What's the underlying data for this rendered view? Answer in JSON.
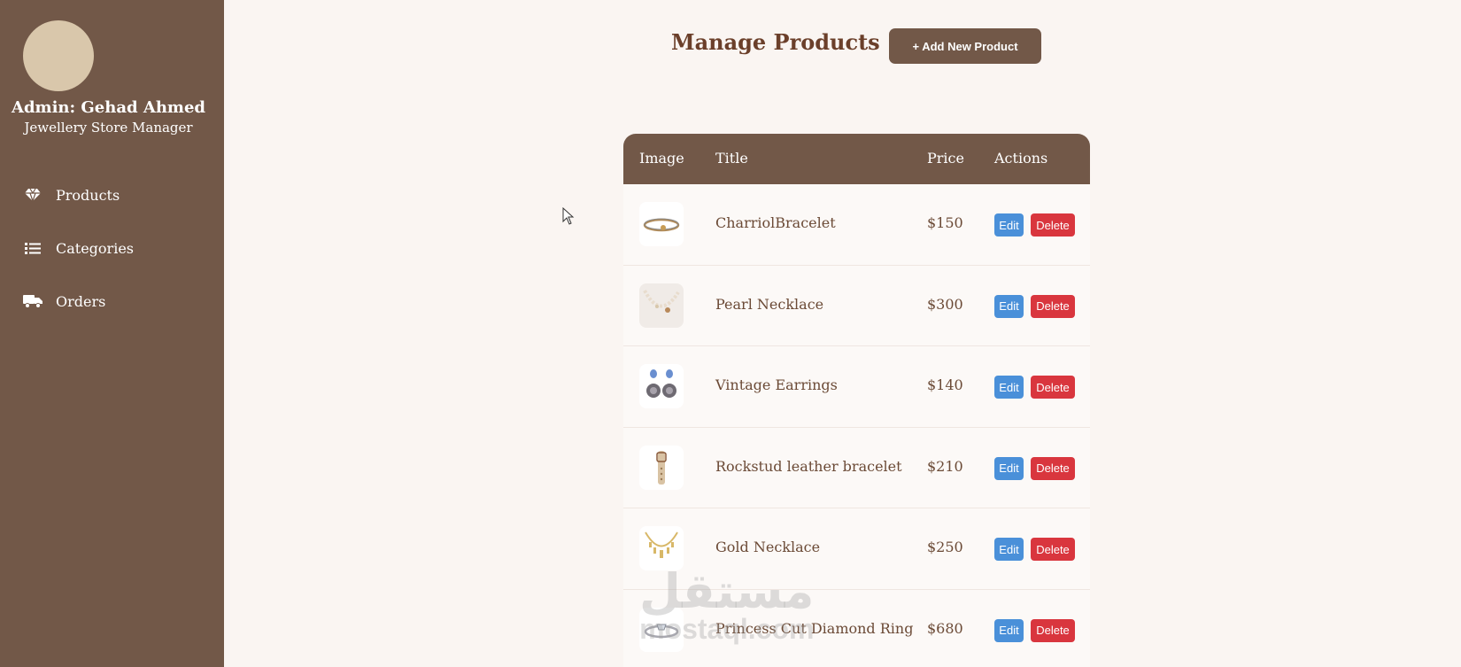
{
  "sidebar": {
    "admin_name": "Admin: Gehad Ahmed",
    "admin_role": "Jewellery Store Manager",
    "items": [
      {
        "label": "Products",
        "icon": "gem-icon"
      },
      {
        "label": "Categories",
        "icon": "list-icon"
      },
      {
        "label": "Orders",
        "icon": "truck-icon"
      }
    ]
  },
  "header": {
    "title": "Manage Products",
    "add_button": "+ Add New Product"
  },
  "table": {
    "columns": [
      "Image",
      "Title",
      "Price",
      "Actions"
    ],
    "edit_label": "Edit",
    "delete_label": "Delete",
    "rows": [
      {
        "title": "CharriolBracelet",
        "price": "$150",
        "image": "bracelet-icon"
      },
      {
        "title": "Pearl Necklace",
        "price": "$300",
        "image": "pearl-necklace-icon"
      },
      {
        "title": "Vintage Earrings",
        "price": "$140",
        "image": "earrings-icon"
      },
      {
        "title": "Rockstud leather bracelet",
        "price": "$210",
        "image": "leather-bracelet-icon"
      },
      {
        "title": "Gold Necklace",
        "price": "$250",
        "image": "gold-necklace-icon"
      },
      {
        "title": "Princess Cut Diamond Ring",
        "price": "$680",
        "image": "ring-icon"
      }
    ]
  },
  "watermark": {
    "arabic": "مستقل",
    "latin": "mostaql.com"
  },
  "colors": {
    "sidebar_bg": "#725848",
    "page_bg": "#faf5f2",
    "edit_button": "#4a90d9",
    "delete_button": "#d9363e",
    "avatar": "#d9c7ab"
  }
}
